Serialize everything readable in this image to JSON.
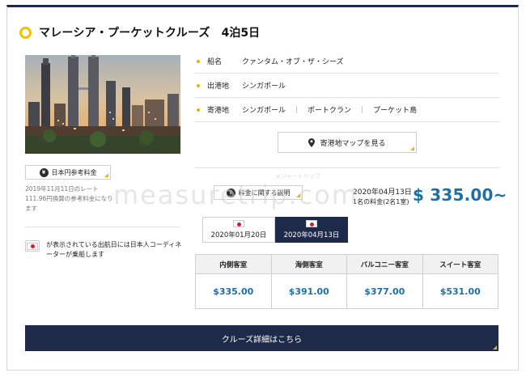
{
  "cruise": {
    "title": "マレーシア・プーケットクルーズ",
    "nights": "4泊5日"
  },
  "info": [
    {
      "label": "船名",
      "value": "クァンタム・オブ・ザ・シーズ"
    },
    {
      "label": "出港地",
      "value": "シンガポール"
    },
    {
      "label": "寄港地",
      "ports": [
        "シンガポール",
        "ポートクラン",
        "プーケット島"
      ],
      "separator": "｜"
    }
  ],
  "map_button": "寄港地マップを見る",
  "jp_reference": {
    "badge": "日本円参考料金",
    "note": "2019年11月11日のレート111.96円換算の参考料金になります"
  },
  "flag_note": "が表示されている出航日には日本人コーディネーターが乗船します",
  "fare_button": "料金に関する説明",
  "price": {
    "date": "2020年04月13日",
    "per_person": "1名の料金(2名1室)",
    "amount": "$ 335.00~"
  },
  "tabs": [
    {
      "label": "2020年01月20日",
      "active": false
    },
    {
      "label": "2020年04月13日",
      "active": true
    }
  ],
  "cabins": [
    {
      "name": "内側客室",
      "price": "$335.00"
    },
    {
      "name": "海側客室",
      "price": "$391.00"
    },
    {
      "name": "バルコニー客室",
      "price": "$377.00"
    },
    {
      "name": "スイート客室",
      "price": "$531.00"
    }
  ],
  "detail_button": "クルーズ詳細はこちら",
  "watermark": "measuretrip.com",
  "watermark_small": "メジャートリップ",
  "colors": {
    "navy": "#1e2a4a",
    "accent_yellow": "#e8b400",
    "price_blue": "#1e6fa6",
    "flag_red": "#d41c30"
  },
  "icons": {
    "title": "ring-icon",
    "badge": "info-circle-icon",
    "map": "map-pin-icon",
    "flag": "japan-flag-icon"
  }
}
